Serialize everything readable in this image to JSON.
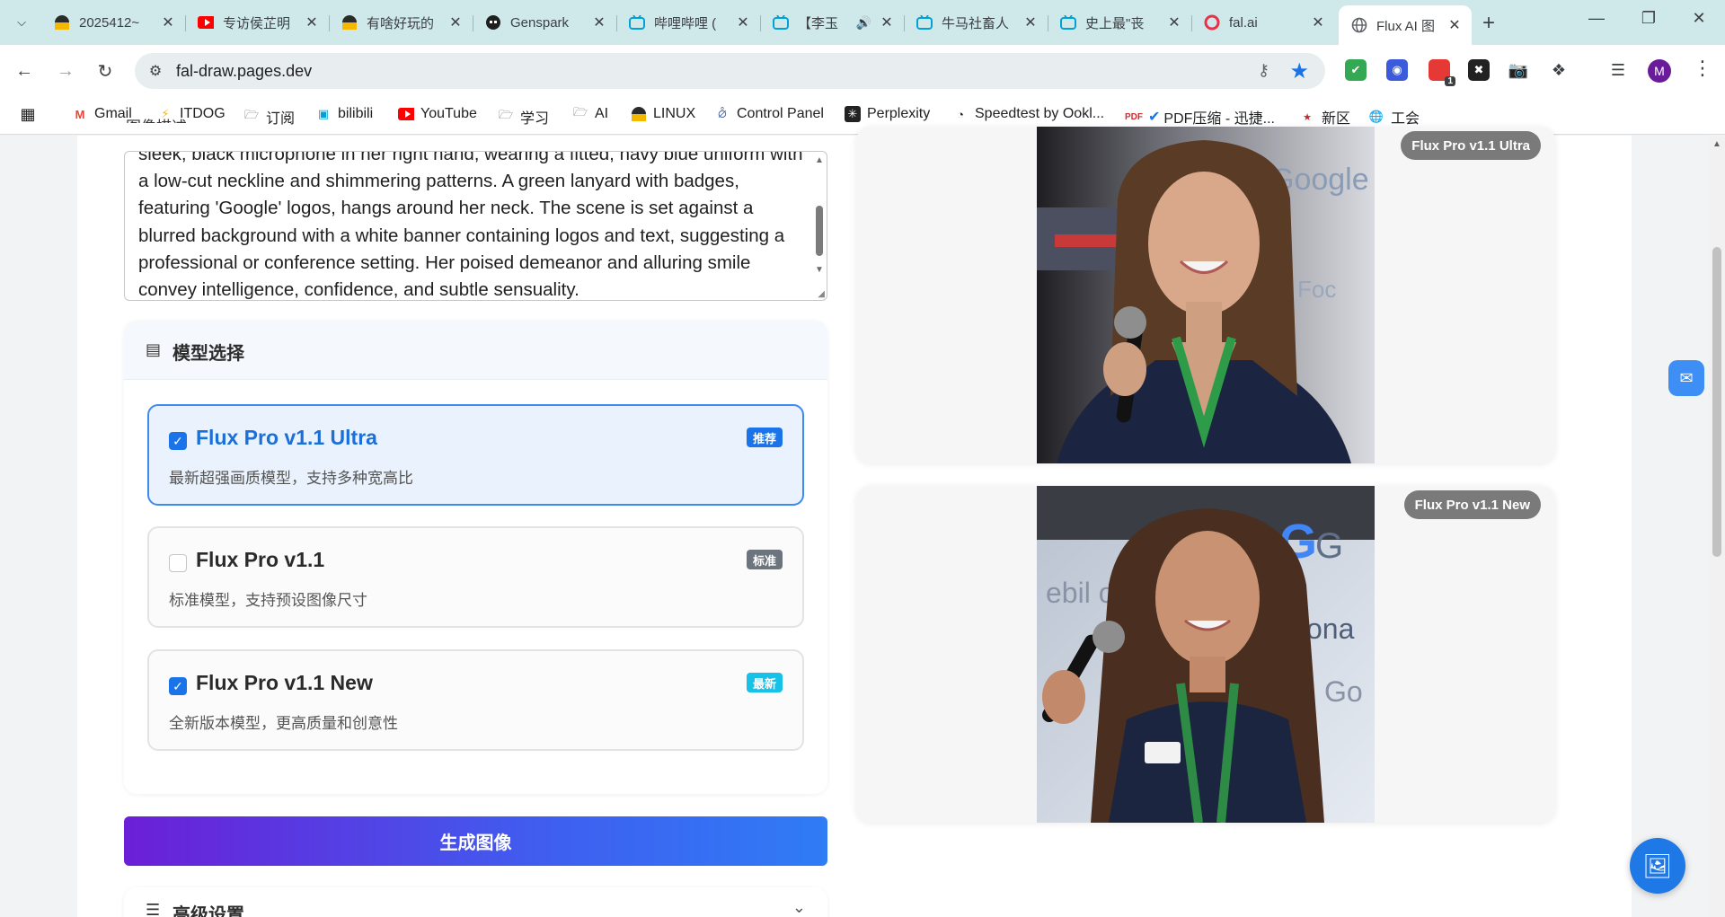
{
  "browser": {
    "tabs": [
      {
        "title": "2025412~",
        "fav_color": "#2b2b2b"
      },
      {
        "title": "专访侯芷明",
        "fav_color": "#ff0000"
      },
      {
        "title": "有啥好玩的",
        "fav_color": "#2b2b2b"
      },
      {
        "title": "Genspark",
        "fav_color": "#1f1f1f"
      },
      {
        "title": "哔哩哔哩 (",
        "fav_color": "#00a1d6"
      },
      {
        "title": "【李玉",
        "fav_color": "#00a1d6"
      },
      {
        "title": "牛马社畜人",
        "fav_color": "#00a1d6"
      },
      {
        "title": "史上最\"丧",
        "fav_color": "#00a1d6"
      },
      {
        "title": "fal.ai",
        "fav_color": "#e8324a"
      },
      {
        "title": "Flux AI 图",
        "fav_color": "#5f6368"
      }
    ],
    "url": "fal-draw.pages.dev",
    "profile_initial": "M",
    "extension_badge": "1",
    "bookmarks": [
      {
        "label": "Gmail",
        "icon": "gmail-icon"
      },
      {
        "label": "ITDOG",
        "icon": "itdog-icon"
      },
      {
        "label": "订阅",
        "icon": "folder-icon"
      },
      {
        "label": "bilibili",
        "icon": "bilibili-icon"
      },
      {
        "label": "YouTube",
        "icon": "youtube-icon"
      },
      {
        "label": "学习",
        "icon": "folder-icon"
      },
      {
        "label": "AI",
        "icon": "folder-icon"
      },
      {
        "label": "LINUX",
        "icon": "linux-icon"
      },
      {
        "label": "Control Panel",
        "icon": "control-panel-icon"
      },
      {
        "label": "Perplexity",
        "icon": "perplexity-icon"
      },
      {
        "label": "Speedtest by Ookl...",
        "icon": "speedtest-icon"
      },
      {
        "label": "PDF压缩 - 迅捷...",
        "icon": "pdf-icon"
      },
      {
        "label": "新区",
        "icon": "news-icon"
      },
      {
        "label": "工会",
        "icon": "globe-icon"
      }
    ]
  },
  "prompt": {
    "label": "图像描述",
    "text": "sleek, black microphone in her right hand, wearing a fitted, navy blue uniform with a low-cut neckline and shimmering patterns. A green lanyard with badges, featuring 'Google' logos, hangs around her neck. The scene is set against a blurred background with a white banner containing logos and text, suggesting a professional or conference setting. Her poised demeanor and alluring smile convey intelligence, confidence, and subtle sensuality."
  },
  "models": {
    "title": "模型选择",
    "items": [
      {
        "name": "Flux Pro v1.1 Ultra",
        "desc": "最新超强画质模型，支持多种宽高比",
        "badge": "推荐",
        "badge_color": "#1a73e8",
        "checked": true
      },
      {
        "name": "Flux Pro v1.1",
        "desc": "标准模型，支持预设图像尺寸",
        "badge": "标准",
        "badge_color": "#6c757d",
        "checked": false
      },
      {
        "name": "Flux Pro v1.1 New",
        "desc": "全新版本模型，更高质量和创意性",
        "badge": "最新",
        "badge_color": "#17c1e8",
        "checked": true
      }
    ]
  },
  "generate_label": "生成图像",
  "advanced": {
    "title": "高级设置"
  },
  "results": [
    {
      "tag": "Flux Pro v1.1 Ultra"
    },
    {
      "tag": "Flux Pro v1.1 New"
    }
  ],
  "colors": {
    "accent": "#1a73e8",
    "button_gradient_start": "#6b1fd6",
    "button_gradient_end": "#2f7cf5"
  }
}
